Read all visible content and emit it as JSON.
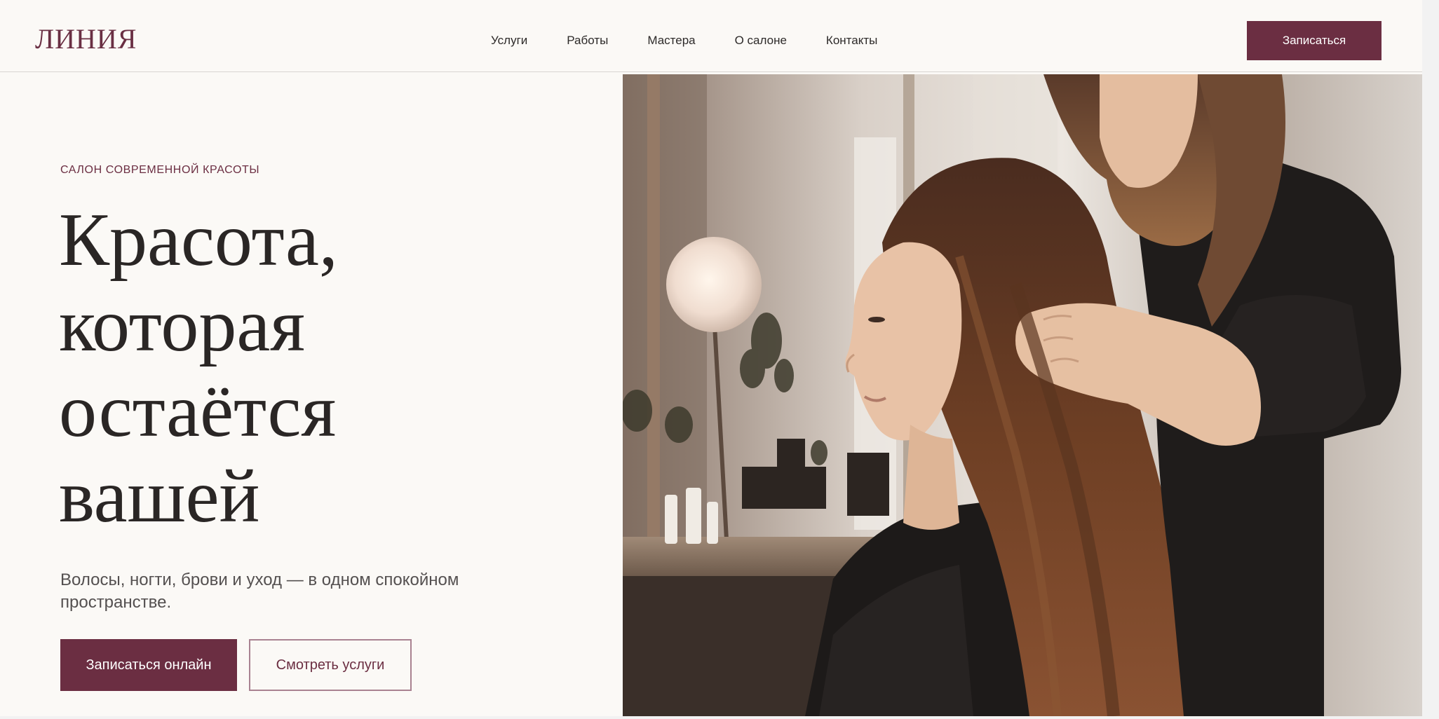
{
  "header": {
    "logo": "ЛИНИЯ",
    "nav": [
      "Услуги",
      "Работы",
      "Мастера",
      "О салоне",
      "Контакты"
    ],
    "cta_label": "Записаться"
  },
  "hero": {
    "kicker": "САЛОН СОВРЕМЕННОЙ КРАСОТЫ",
    "headline_lines": [
      "Красота,",
      "которая",
      "остаётся",
      "вашей"
    ],
    "subtitle": "Волосы, ногти, брови и уход — в одном спокойном пространстве.",
    "primary_button": "Записаться онлайн",
    "secondary_button": "Смотреть услуги",
    "image_icon": "salon-photo-icon"
  },
  "colors": {
    "accent": "#6b2e42",
    "background": "#fbf9f6",
    "text": "#2a2625"
  }
}
